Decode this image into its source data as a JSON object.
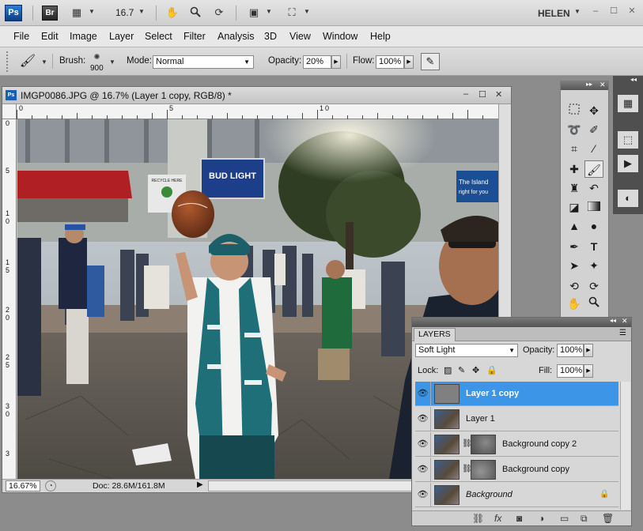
{
  "appbar": {
    "ps_logo": "Ps",
    "br_logo": "Br",
    "zoom": "16.7",
    "user": "HELEN"
  },
  "menu": [
    "File",
    "Edit",
    "Image",
    "Layer",
    "Select",
    "Filter",
    "Analysis",
    "3D",
    "View",
    "Window",
    "Help"
  ],
  "options": {
    "brush_label": "Brush:",
    "brush_size": "900",
    "mode_label": "Mode:",
    "mode_value": "Normal",
    "opacity_label": "Opacity:",
    "opacity_value": "20%",
    "flow_label": "Flow:",
    "flow_value": "100%"
  },
  "document": {
    "title": "IMGP0086.JPG @ 16.7% (Layer 1 copy, RGB/8) *",
    "zoom": "16.67%",
    "doc_size": "Doc: 28.6M/161.8M",
    "ruler_top": [
      "0",
      "5",
      "1",
      "0"
    ],
    "ruler_left": [
      "0",
      "5",
      "1",
      "0",
      "1",
      "5",
      "2",
      "0",
      "2",
      "5",
      "3",
      "0",
      "3",
      "5"
    ],
    "photo": {
      "sign_left": "BUD LIGHT",
      "sign_recycle": "RECYCLE HERE",
      "sign_right_1": "The Island",
      "sign_right_2": "right for you"
    }
  },
  "layers": {
    "tab": "LAYERS",
    "blend_mode": "Soft Light",
    "opacity_label": "Opacity:",
    "opacity_value": "100%",
    "lock_label": "Lock:",
    "fill_label": "Fill:",
    "fill_value": "100%",
    "items": [
      {
        "name": "Layer 1 copy",
        "active": true
      },
      {
        "name": "Layer 1",
        "active": false
      },
      {
        "name": "Background copy 2",
        "active": false
      },
      {
        "name": "Background copy",
        "active": false
      },
      {
        "name": "Background",
        "active": false
      }
    ]
  },
  "colors": {
    "accent": "#3d95e7",
    "ps_blue": "#1c5fb0",
    "panel": "#d7d7d7"
  }
}
